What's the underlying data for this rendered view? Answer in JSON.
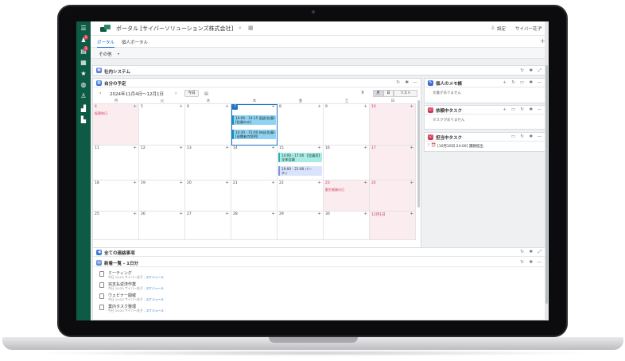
{
  "header": {
    "portal_title": "ポータル [サイバーソリューションズ株式会社]",
    "settings_label": "設定",
    "user_name": "サイバー花子"
  },
  "tabs": [
    {
      "label": "ポータル"
    },
    {
      "label": "個人ポータル"
    }
  ],
  "filter": {
    "label": "その他"
  },
  "company_system": {
    "title": "社内システム"
  },
  "schedule": {
    "title": "自分の予定",
    "range": "2024年11月4日〜12月1日",
    "today_label": "今日",
    "view_month": "月",
    "view_day": "日",
    "view_list": "リスト",
    "weekdays": [
      "月",
      "火",
      "水",
      "木",
      "金",
      "土",
      "日"
    ],
    "weeks": [
      [
        "4",
        "5",
        "6",
        "7",
        "8",
        "9",
        "10"
      ],
      [
        "11",
        "12",
        "13",
        "14",
        "15",
        "16",
        "17"
      ],
      [
        "18",
        "19",
        "20",
        "21",
        "22",
        "23",
        "24"
      ],
      [
        "25",
        "26",
        "27",
        "28",
        "29",
        "30",
        "12月1日"
      ]
    ],
    "holidays": {
      "h1": "振替休日",
      "h2": "勤労感謝の日"
    },
    "events": {
      "e1": "14:00 - 14:15 面談(佐藤)",
      "e1b": "[従業のみ]",
      "e2": "14:30 - 15:00 持出(佐藤)",
      "e2b": "[退職者の説明]",
      "e3": "14:00 - 17:00 【会議室】",
      "e3b": "全体会議",
      "e4": "19:00 - 21:00 パー",
      "e4b": "ティ"
    }
  },
  "memo": {
    "title": "個人のメモ帳",
    "empty": "文書がありません"
  },
  "requested_tasks": {
    "title": "依頼中タスク",
    "empty": "タスクがありません"
  },
  "assigned_tasks": {
    "title": "担当中タスク",
    "item": "[10月16日 24:00] 課題提出"
  },
  "notices": {
    "title": "全ての連絡事項"
  },
  "news": {
    "title": "新着一覧 - 1日分",
    "items": [
      {
        "title": "ミーティング",
        "meta_prefix": "今日 10:20 サイバー花子 -",
        "link": "スケジュール"
      },
      {
        "title": "完支払返済作業",
        "meta_prefix": "今日 10:20 サイバー花子 -",
        "link": "スケジュール"
      },
      {
        "title": "ウェビナー開催",
        "meta_prefix": "今日 10:20 サイバー花子 -",
        "link": "スケジュール"
      },
      {
        "title": "業内タスク整理",
        "meta_prefix": "今日 10:20 サイバー花子 -",
        "link": "スケジュール"
      }
    ]
  },
  "colors": {
    "sidebar": "#0f5a44",
    "accent": "#1a73c8",
    "holiday_bg": "#fbecef",
    "holiday_text": "#d0385a",
    "event_blue": "#8fd3f2",
    "event_cyan": "#a8ece6"
  }
}
